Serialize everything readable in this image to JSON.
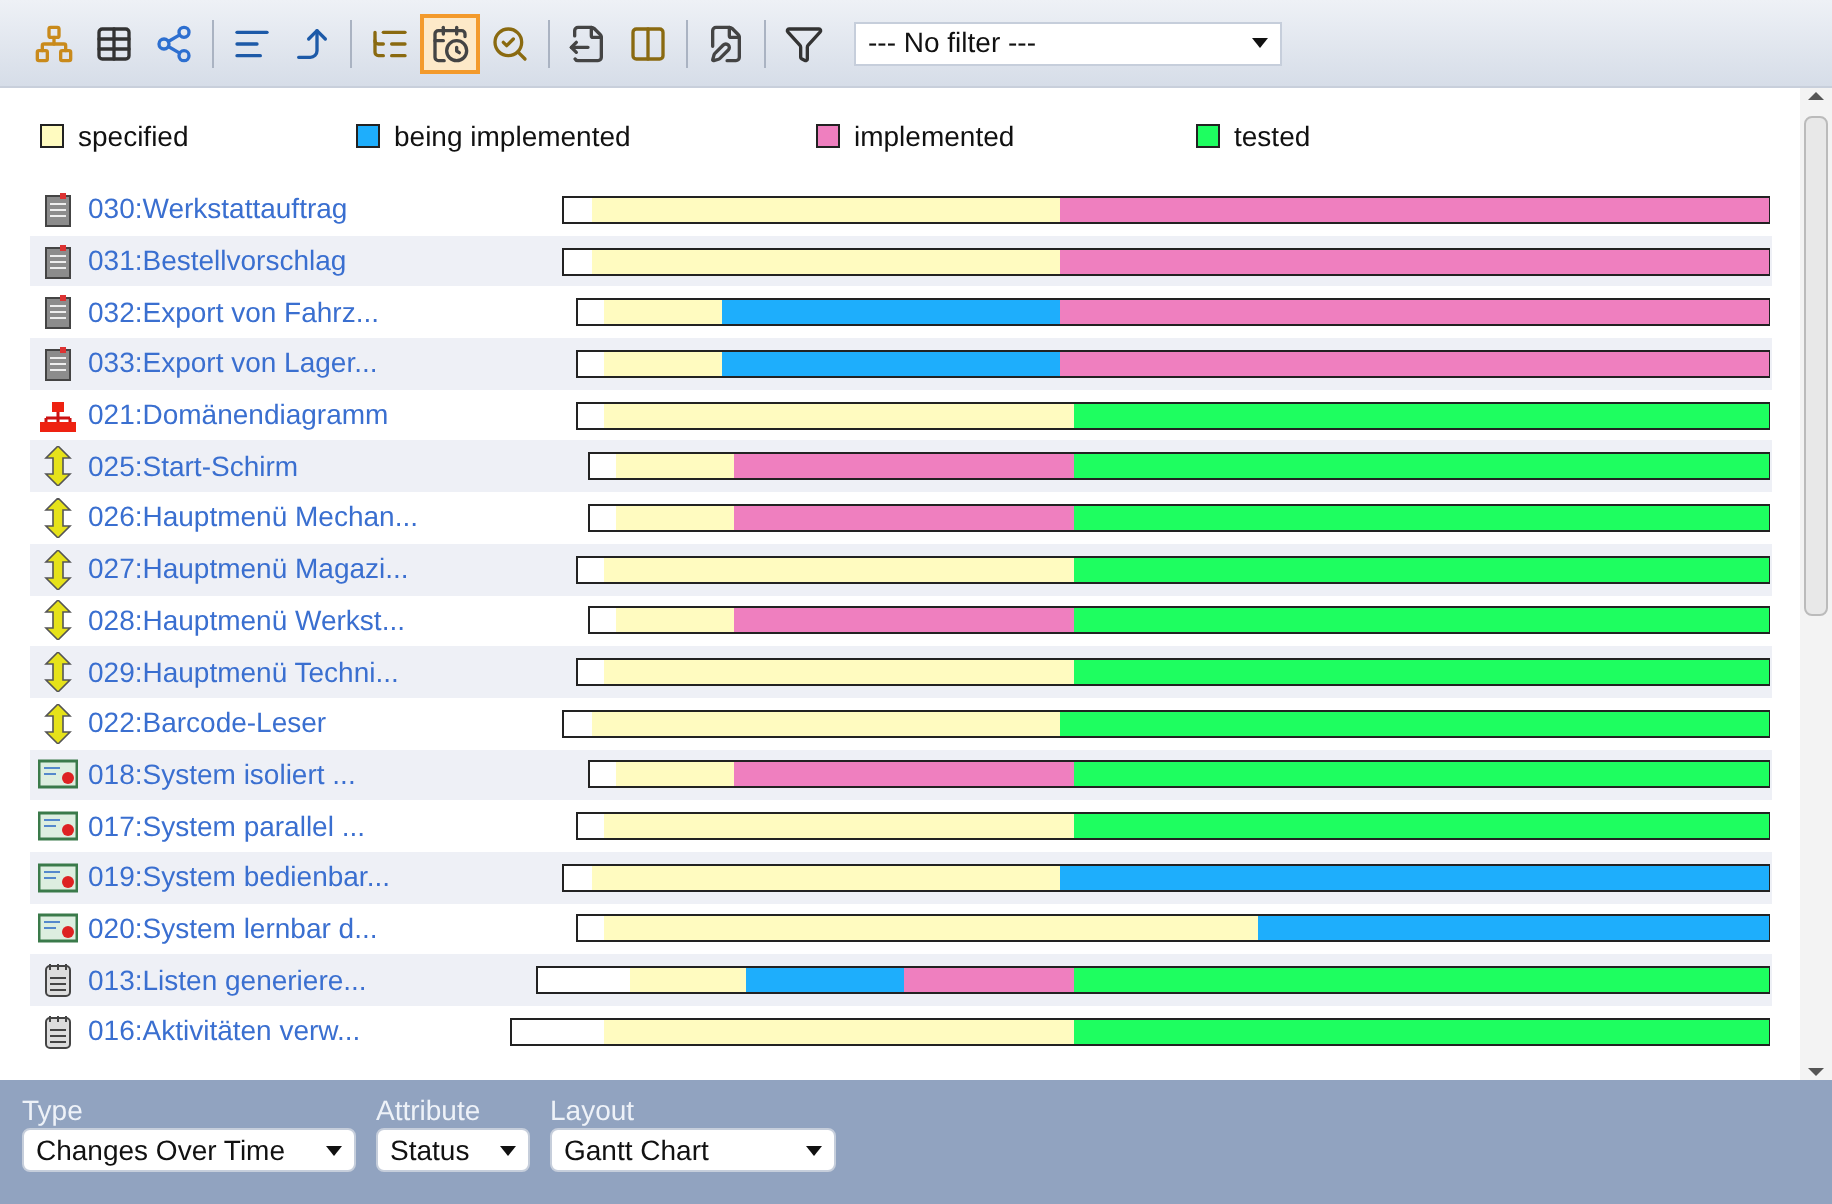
{
  "toolbar": {
    "groups": [
      [
        {
          "kind": "hierarchy",
          "selected": false
        },
        {
          "kind": "table",
          "selected": false
        },
        {
          "kind": "network",
          "selected": false
        }
      ],
      [
        {
          "kind": "align",
          "selected": false
        },
        {
          "kind": "arrow",
          "selected": false
        }
      ],
      [
        {
          "kind": "tree",
          "selected": false
        },
        {
          "kind": "calendar",
          "selected": true
        },
        {
          "kind": "search",
          "selected": false
        }
      ],
      [
        {
          "kind": "export",
          "selected": false
        },
        {
          "kind": "compare",
          "selected": false
        }
      ],
      [
        {
          "kind": "edit",
          "selected": false
        }
      ],
      [
        {
          "kind": "filter",
          "selected": false
        }
      ]
    ],
    "filter": {
      "value": "--- No filter ---"
    }
  },
  "legend": [
    {
      "label": "specified",
      "color": "#fffbc0"
    },
    {
      "label": "being implemented",
      "color": "#1eaefc"
    },
    {
      "label": "implemented",
      "color": "#ef7fbf"
    },
    {
      "label": "tested",
      "color": "#1efe60"
    }
  ],
  "rows": [
    {
      "name": "030:Werkstattauftrag",
      "kind": "document"
    },
    {
      "name": "031:Bestellvorschlag",
      "kind": "document"
    },
    {
      "name": "032:Export von Fahrz...",
      "kind": "document"
    },
    {
      "name": "033:Export von Lager...",
      "kind": "document"
    },
    {
      "name": "021:Domänendiagramm",
      "kind": "diagram"
    },
    {
      "name": "025:Start-Schirm",
      "kind": "arrows"
    },
    {
      "name": "026:Hauptmenü Mechan...",
      "kind": "arrows"
    },
    {
      "name": "027:Hauptmenü Magazi...",
      "kind": "arrows"
    },
    {
      "name": "028:Hauptmenü Werkst...",
      "kind": "arrows"
    },
    {
      "name": "029:Hauptmenü Techni...",
      "kind": "arrows"
    },
    {
      "name": "022:Barcode-Leser",
      "kind": "arrows"
    },
    {
      "name": "018:System isoliert ...",
      "kind": "certificate"
    },
    {
      "name": "017:System parallel ...",
      "kind": "certificate"
    },
    {
      "name": "019:System bedienbar...",
      "kind": "certificate"
    },
    {
      "name": "020:System lernbar d...",
      "kind": "certificate"
    },
    {
      "name": "013:Listen generiere...",
      "kind": "notepad"
    },
    {
      "name": "016:Aktivitäten verw...",
      "kind": "notepad"
    }
  ],
  "controls": [
    {
      "label": "Type",
      "value": "Changes Over Time"
    },
    {
      "label": "Attribute",
      "value": "Status"
    },
    {
      "label": "Layout",
      "value": "Gantt Chart"
    }
  ]
}
